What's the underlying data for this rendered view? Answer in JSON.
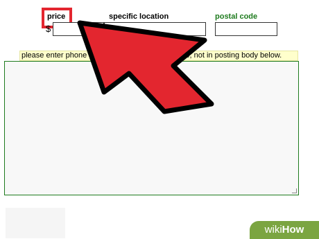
{
  "form": {
    "price_label": "price",
    "currency_symbol": "$",
    "location_label": "specific location",
    "postal_label": "postal code",
    "price_value": "",
    "location_value": "",
    "postal_value": "",
    "notice_text": "please enter phone num",
    "notice_text_end": "bove, not in posting body below.",
    "body_value": ""
  },
  "annotation": {
    "arrow_color": "#e3262f",
    "highlight_color": "#e3262f"
  },
  "watermark": {
    "brand": "wiki",
    "brand_bold": "How"
  },
  "colors": {
    "green_label": "#1e7b1e",
    "notice_bg": "#ffffcc",
    "watermark_bg": "#7ba541"
  }
}
